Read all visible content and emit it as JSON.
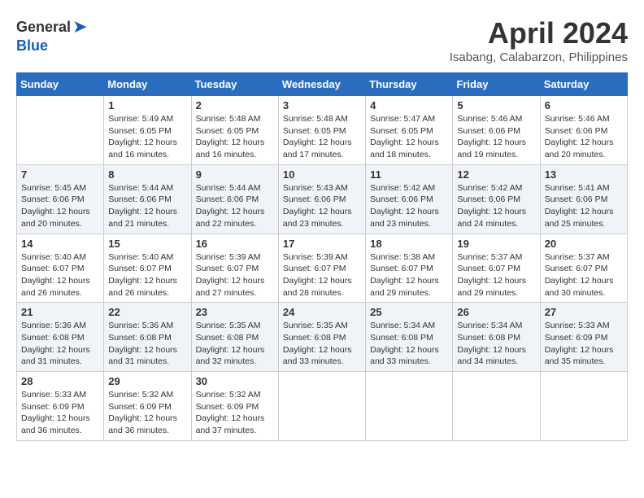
{
  "logo": {
    "general": "General",
    "blue": "Blue"
  },
  "title": "April 2024",
  "subtitle": "Isabang, Calabarzon, Philippines",
  "days_header": [
    "Sunday",
    "Monday",
    "Tuesday",
    "Wednesday",
    "Thursday",
    "Friday",
    "Saturday"
  ],
  "weeks": [
    [
      {
        "num": "",
        "info": ""
      },
      {
        "num": "1",
        "info": "Sunrise: 5:49 AM\nSunset: 6:05 PM\nDaylight: 12 hours\nand 16 minutes."
      },
      {
        "num": "2",
        "info": "Sunrise: 5:48 AM\nSunset: 6:05 PM\nDaylight: 12 hours\nand 16 minutes."
      },
      {
        "num": "3",
        "info": "Sunrise: 5:48 AM\nSunset: 6:05 PM\nDaylight: 12 hours\nand 17 minutes."
      },
      {
        "num": "4",
        "info": "Sunrise: 5:47 AM\nSunset: 6:05 PM\nDaylight: 12 hours\nand 18 minutes."
      },
      {
        "num": "5",
        "info": "Sunrise: 5:46 AM\nSunset: 6:06 PM\nDaylight: 12 hours\nand 19 minutes."
      },
      {
        "num": "6",
        "info": "Sunrise: 5:46 AM\nSunset: 6:06 PM\nDaylight: 12 hours\nand 20 minutes."
      }
    ],
    [
      {
        "num": "7",
        "info": "Sunrise: 5:45 AM\nSunset: 6:06 PM\nDaylight: 12 hours\nand 20 minutes."
      },
      {
        "num": "8",
        "info": "Sunrise: 5:44 AM\nSunset: 6:06 PM\nDaylight: 12 hours\nand 21 minutes."
      },
      {
        "num": "9",
        "info": "Sunrise: 5:44 AM\nSunset: 6:06 PM\nDaylight: 12 hours\nand 22 minutes."
      },
      {
        "num": "10",
        "info": "Sunrise: 5:43 AM\nSunset: 6:06 PM\nDaylight: 12 hours\nand 23 minutes."
      },
      {
        "num": "11",
        "info": "Sunrise: 5:42 AM\nSunset: 6:06 PM\nDaylight: 12 hours\nand 23 minutes."
      },
      {
        "num": "12",
        "info": "Sunrise: 5:42 AM\nSunset: 6:06 PM\nDaylight: 12 hours\nand 24 minutes."
      },
      {
        "num": "13",
        "info": "Sunrise: 5:41 AM\nSunset: 6:06 PM\nDaylight: 12 hours\nand 25 minutes."
      }
    ],
    [
      {
        "num": "14",
        "info": "Sunrise: 5:40 AM\nSunset: 6:07 PM\nDaylight: 12 hours\nand 26 minutes."
      },
      {
        "num": "15",
        "info": "Sunrise: 5:40 AM\nSunset: 6:07 PM\nDaylight: 12 hours\nand 26 minutes."
      },
      {
        "num": "16",
        "info": "Sunrise: 5:39 AM\nSunset: 6:07 PM\nDaylight: 12 hours\nand 27 minutes."
      },
      {
        "num": "17",
        "info": "Sunrise: 5:39 AM\nSunset: 6:07 PM\nDaylight: 12 hours\nand 28 minutes."
      },
      {
        "num": "18",
        "info": "Sunrise: 5:38 AM\nSunset: 6:07 PM\nDaylight: 12 hours\nand 29 minutes."
      },
      {
        "num": "19",
        "info": "Sunrise: 5:37 AM\nSunset: 6:07 PM\nDaylight: 12 hours\nand 29 minutes."
      },
      {
        "num": "20",
        "info": "Sunrise: 5:37 AM\nSunset: 6:07 PM\nDaylight: 12 hours\nand 30 minutes."
      }
    ],
    [
      {
        "num": "21",
        "info": "Sunrise: 5:36 AM\nSunset: 6:08 PM\nDaylight: 12 hours\nand 31 minutes."
      },
      {
        "num": "22",
        "info": "Sunrise: 5:36 AM\nSunset: 6:08 PM\nDaylight: 12 hours\nand 31 minutes."
      },
      {
        "num": "23",
        "info": "Sunrise: 5:35 AM\nSunset: 6:08 PM\nDaylight: 12 hours\nand 32 minutes."
      },
      {
        "num": "24",
        "info": "Sunrise: 5:35 AM\nSunset: 6:08 PM\nDaylight: 12 hours\nand 33 minutes."
      },
      {
        "num": "25",
        "info": "Sunrise: 5:34 AM\nSunset: 6:08 PM\nDaylight: 12 hours\nand 33 minutes."
      },
      {
        "num": "26",
        "info": "Sunrise: 5:34 AM\nSunset: 6:08 PM\nDaylight: 12 hours\nand 34 minutes."
      },
      {
        "num": "27",
        "info": "Sunrise: 5:33 AM\nSunset: 6:09 PM\nDaylight: 12 hours\nand 35 minutes."
      }
    ],
    [
      {
        "num": "28",
        "info": "Sunrise: 5:33 AM\nSunset: 6:09 PM\nDaylight: 12 hours\nand 36 minutes."
      },
      {
        "num": "29",
        "info": "Sunrise: 5:32 AM\nSunset: 6:09 PM\nDaylight: 12 hours\nand 36 minutes."
      },
      {
        "num": "30",
        "info": "Sunrise: 5:32 AM\nSunset: 6:09 PM\nDaylight: 12 hours\nand 37 minutes."
      },
      {
        "num": "",
        "info": ""
      },
      {
        "num": "",
        "info": ""
      },
      {
        "num": "",
        "info": ""
      },
      {
        "num": "",
        "info": ""
      }
    ]
  ]
}
